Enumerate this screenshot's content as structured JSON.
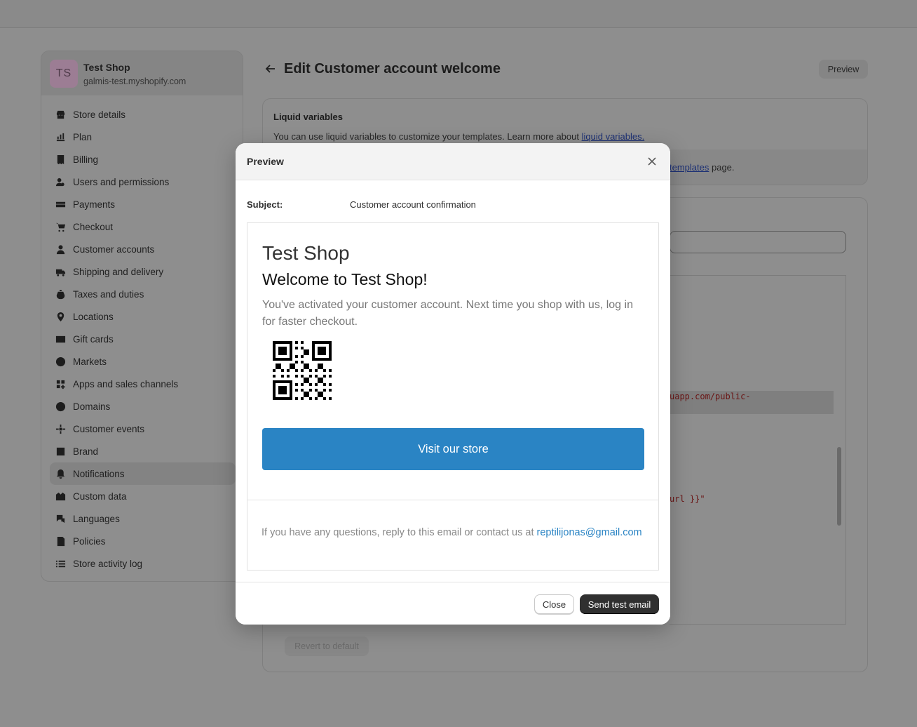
{
  "shop": {
    "initials": "TS",
    "name": "Test Shop",
    "domain": "galmis-test.myshopify.com"
  },
  "sidebar": {
    "items": [
      {
        "label": "Store details",
        "icon": "store-icon"
      },
      {
        "label": "Plan",
        "icon": "plan-icon"
      },
      {
        "label": "Billing",
        "icon": "billing-icon"
      },
      {
        "label": "Users and permissions",
        "icon": "users-icon"
      },
      {
        "label": "Payments",
        "icon": "payments-icon"
      },
      {
        "label": "Checkout",
        "icon": "cart-icon"
      },
      {
        "label": "Customer accounts",
        "icon": "person-icon"
      },
      {
        "label": "Shipping and delivery",
        "icon": "truck-icon"
      },
      {
        "label": "Taxes and duties",
        "icon": "tax-icon"
      },
      {
        "label": "Locations",
        "icon": "location-icon"
      },
      {
        "label": "Gift cards",
        "icon": "gift-card-icon"
      },
      {
        "label": "Markets",
        "icon": "globe-icon"
      },
      {
        "label": "Apps and sales channels",
        "icon": "apps-icon"
      },
      {
        "label": "Domains",
        "icon": "domains-icon"
      },
      {
        "label": "Customer events",
        "icon": "events-icon"
      },
      {
        "label": "Brand",
        "icon": "brand-icon"
      },
      {
        "label": "Notifications",
        "icon": "bell-icon",
        "active": true
      },
      {
        "label": "Custom data",
        "icon": "data-icon"
      },
      {
        "label": "Languages",
        "icon": "language-icon"
      },
      {
        "label": "Policies",
        "icon": "policy-icon"
      },
      {
        "label": "Store activity log",
        "icon": "list-icon"
      }
    ]
  },
  "header": {
    "title": "Edit Customer account welcome",
    "preview_label": "Preview"
  },
  "liquid_card": {
    "title": "Liquid variables",
    "text": "You can use liquid variables to customize your templates. Learn more about ",
    "link": "liquid variables.",
    "band_link": "templates",
    "band_suffix": " page."
  },
  "editor": {
    "code_line_1": "uapp.com/public-",
    "code_line_2": "url }}\"",
    "revert_label": "Revert to default"
  },
  "modal": {
    "title": "Preview",
    "subject_label": "Subject:",
    "subject_value": "Customer account confirmation",
    "email": {
      "shop_name": "Test Shop",
      "heading": "Welcome to Test Shop!",
      "body": "You've activated your customer account. Next time you shop with us, log in for faster checkout.",
      "button": "Visit our store",
      "footer_text": "If you have any questions, reply to this email or contact us at ",
      "footer_email": "reptilijonas@gmail.com"
    },
    "close_label": "Close",
    "send_label": "Send test email"
  },
  "colors": {
    "button_blue": "#2a84c4",
    "primary_dark": "#303030"
  }
}
